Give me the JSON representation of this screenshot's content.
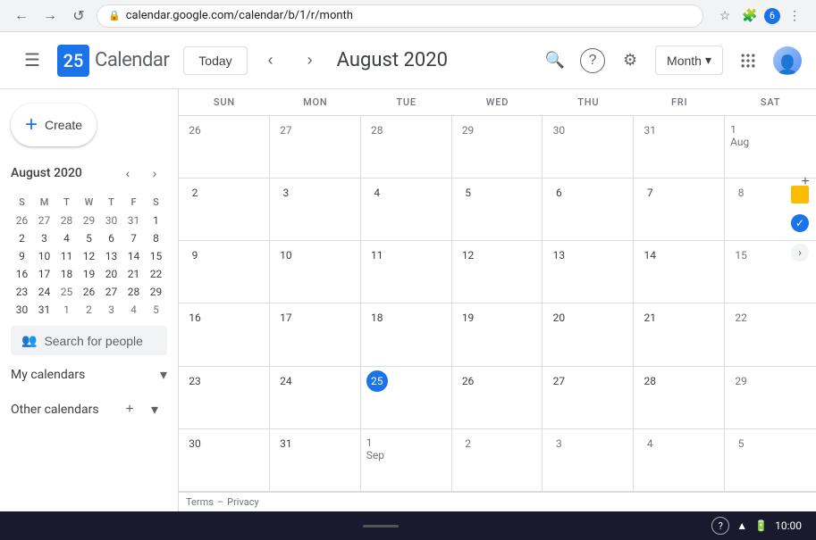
{
  "browser": {
    "back_label": "←",
    "forward_label": "→",
    "refresh_label": "↺",
    "url": "calendar.google.com/calendar/b/1/r/month",
    "star_icon": "☆",
    "extensions_icon": "🧩",
    "badge_count": "6",
    "more_icon": "⋮"
  },
  "topbar": {
    "menu_icon": "☰",
    "logo_date": "25",
    "logo_text": "Calendar",
    "today_label": "Today",
    "prev_icon": "‹",
    "next_icon": "›",
    "month_title": "August 2020",
    "search_icon": "🔍",
    "help_icon": "?",
    "settings_icon": "⚙",
    "view_label": "Month",
    "view_arrow": "▾",
    "grid_icon": "⋮⋮⋮"
  },
  "sidebar": {
    "create_label": "Create",
    "mini_cal_title": "August 2020",
    "mini_cal_prev": "‹",
    "mini_cal_next": "›",
    "days_of_week": [
      "S",
      "M",
      "T",
      "W",
      "T",
      "F",
      "S"
    ],
    "weeks": [
      [
        "26",
        "27",
        "28",
        "29",
        "30",
        "31",
        "1"
      ],
      [
        "2",
        "3",
        "4",
        "5",
        "6",
        "7",
        "8"
      ],
      [
        "9",
        "10",
        "11",
        "12",
        "13",
        "14",
        "15"
      ],
      [
        "16",
        "17",
        "18",
        "19",
        "20",
        "21",
        "22"
      ],
      [
        "23",
        "24",
        "25",
        "26",
        "27",
        "28",
        "29"
      ],
      [
        "30",
        "31",
        "1",
        "2",
        "3",
        "4",
        "5"
      ]
    ],
    "weeks_other": [
      [
        true,
        true,
        true,
        true,
        true,
        true,
        false
      ],
      [
        false,
        false,
        false,
        false,
        false,
        false,
        false
      ],
      [
        false,
        false,
        false,
        false,
        false,
        false,
        false
      ],
      [
        false,
        false,
        false,
        false,
        false,
        false,
        false
      ],
      [
        false,
        false,
        true,
        false,
        false,
        false,
        false
      ],
      [
        false,
        false,
        true,
        true,
        true,
        true,
        true
      ]
    ],
    "today_cell": "25",
    "search_people_label": "Search for people",
    "my_calendars_label": "My calendars",
    "other_calendars_label": "Other calendars",
    "add_cal_icon": "+",
    "expand_icon": "▾"
  },
  "calendar": {
    "headers": [
      "SUN",
      "MON",
      "TUE",
      "WED",
      "THU",
      "FRI",
      "SAT"
    ],
    "rows": [
      [
        {
          "num": "26",
          "other": true
        },
        {
          "num": "27",
          "other": true
        },
        {
          "num": "28",
          "other": true
        },
        {
          "num": "29",
          "other": true
        },
        {
          "num": "30",
          "other": true
        },
        {
          "num": "31",
          "other": true
        },
        {
          "num": "1 Aug",
          "other": false,
          "sat": true
        }
      ],
      [
        {
          "num": "2",
          "other": false
        },
        {
          "num": "3",
          "other": false
        },
        {
          "num": "4",
          "other": false
        },
        {
          "num": "5",
          "other": false
        },
        {
          "num": "6",
          "other": false
        },
        {
          "num": "7",
          "other": false
        },
        {
          "num": "8",
          "other": false,
          "sat": true
        }
      ],
      [
        {
          "num": "9",
          "other": false
        },
        {
          "num": "10",
          "other": false
        },
        {
          "num": "11",
          "other": false
        },
        {
          "num": "12",
          "other": false
        },
        {
          "num": "13",
          "other": false
        },
        {
          "num": "14",
          "other": false
        },
        {
          "num": "15",
          "other": false,
          "sat": true
        }
      ],
      [
        {
          "num": "16",
          "other": false
        },
        {
          "num": "17",
          "other": false
        },
        {
          "num": "18",
          "other": false
        },
        {
          "num": "19",
          "other": false
        },
        {
          "num": "20",
          "other": false
        },
        {
          "num": "21",
          "other": false
        },
        {
          "num": "22",
          "other": false,
          "sat": true
        }
      ],
      [
        {
          "num": "23",
          "other": false
        },
        {
          "num": "24",
          "other": false
        },
        {
          "num": "25",
          "today": true
        },
        {
          "num": "26",
          "other": false
        },
        {
          "num": "27",
          "other": false
        },
        {
          "num": "28",
          "other": false
        },
        {
          "num": "29",
          "other": false,
          "sat": true
        }
      ],
      [
        {
          "num": "30",
          "other": false
        },
        {
          "num": "31",
          "other": false
        },
        {
          "num": "1 Sep",
          "other": true
        },
        {
          "num": "2",
          "other": true
        },
        {
          "num": "3",
          "other": true
        },
        {
          "num": "4",
          "other": true
        },
        {
          "num": "5",
          "other": true,
          "sat": true
        }
      ]
    ]
  },
  "terms": {
    "terms_label": "Terms",
    "separator": "–",
    "privacy_label": "Privacy"
  },
  "taskbar": {
    "wifi_icon": "▲",
    "battery_icon": "🔋",
    "time": "10:00",
    "help_icon": "?"
  }
}
